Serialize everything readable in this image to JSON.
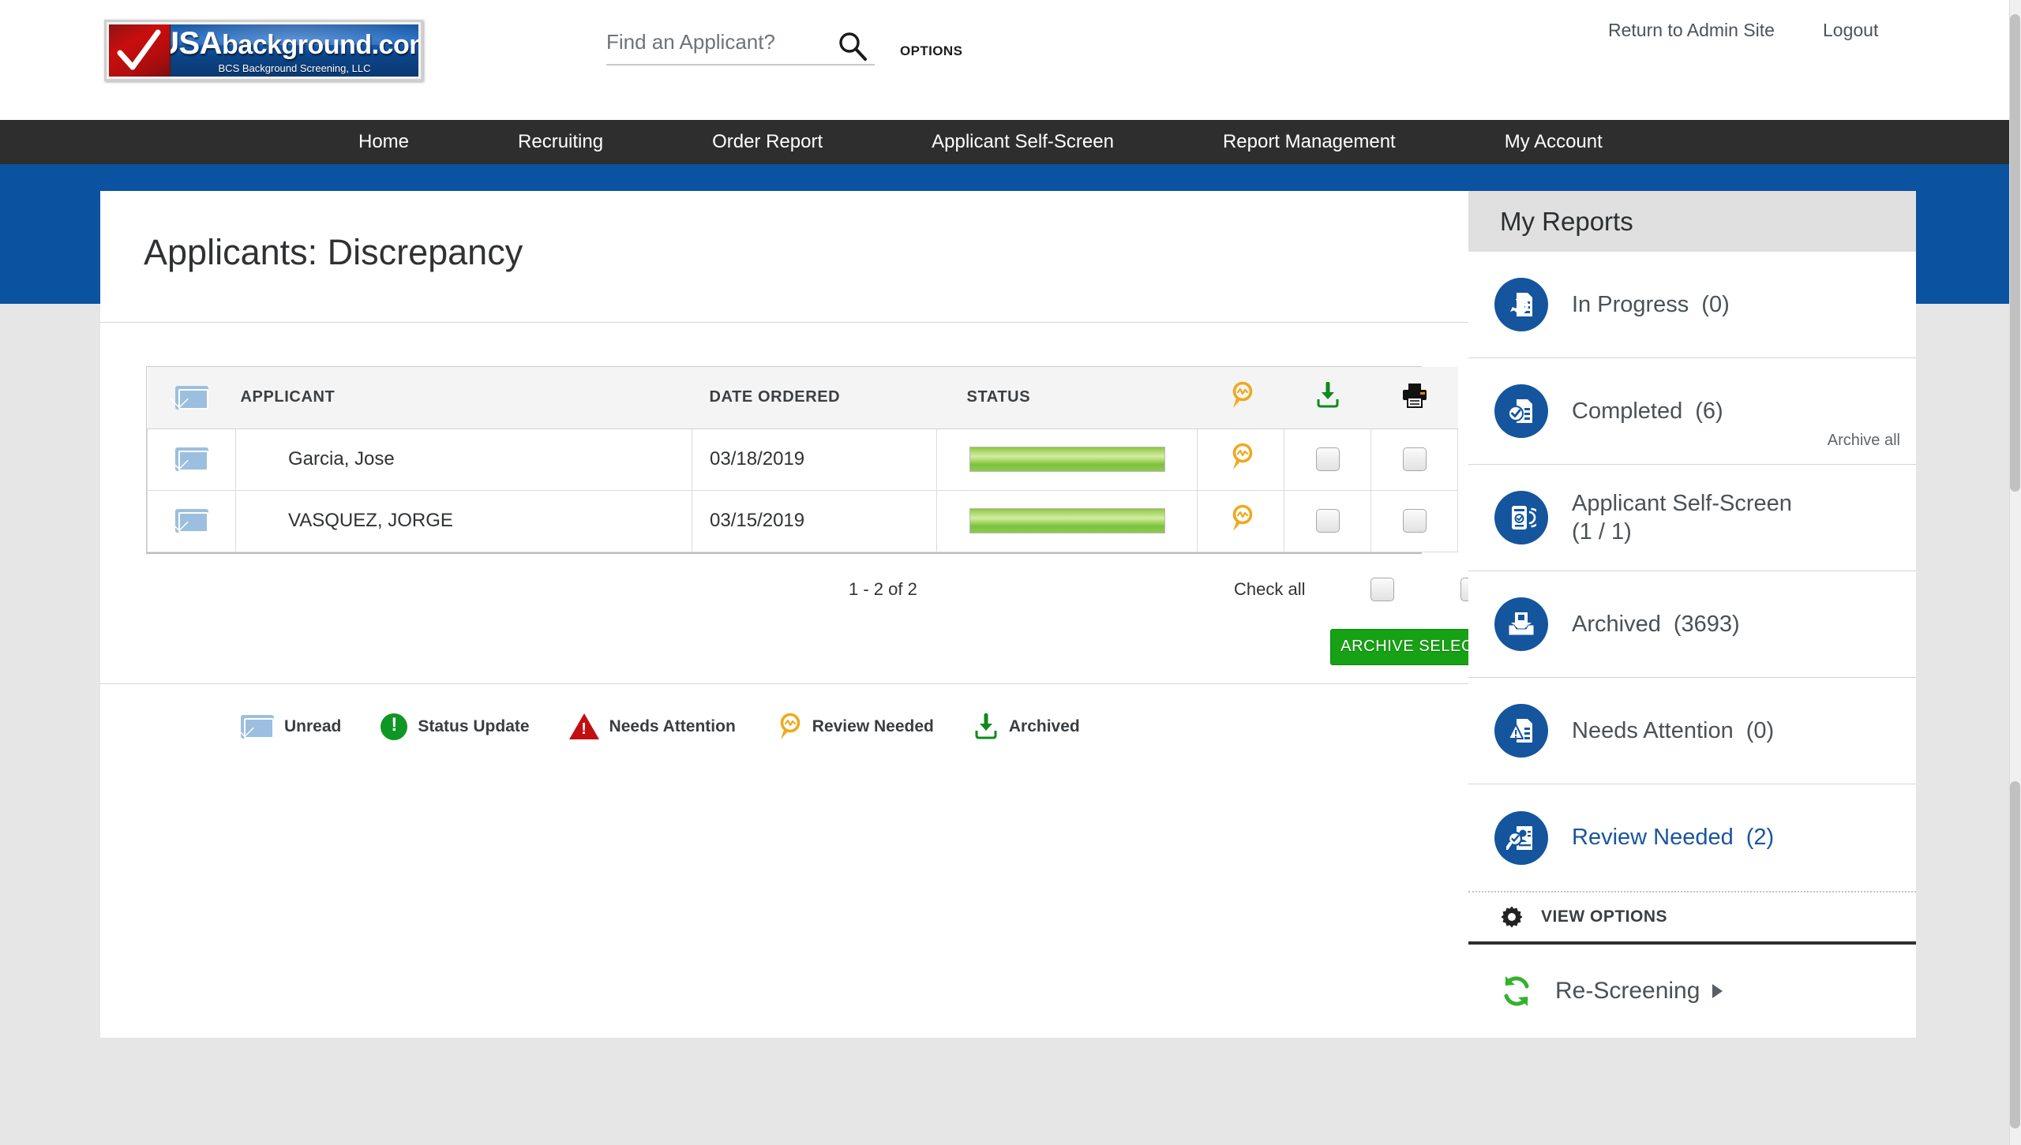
{
  "header": {
    "logo": {
      "main_usa": "USA",
      "main_rest": "background.com",
      "sub": "BCS Background Screening, LLC",
      "check_icon": "checkmark-icon"
    },
    "search": {
      "placeholder": "Find an Applicant?",
      "value": "",
      "icon": "search-icon"
    },
    "options_label": "OPTIONS",
    "admin_link": "Return to Admin Site",
    "logout_link": "Logout"
  },
  "nav": {
    "items": [
      {
        "label": "Home"
      },
      {
        "label": "Recruiting"
      },
      {
        "label": "Order Report"
      },
      {
        "label": "Applicant Self-Screen"
      },
      {
        "label": "Report Management"
      },
      {
        "label": "My Account"
      }
    ]
  },
  "page": {
    "title": "Applicants: Discrepancy"
  },
  "table": {
    "columns": {
      "envelope": "",
      "applicant": "APPLICANT",
      "date_ordered": "DATE ORDERED",
      "status": "STATUS",
      "review": "review-needed-icon",
      "download": "archived-download-icon",
      "print": "printer-icon"
    },
    "rows": [
      {
        "envelope": "unread-envelope-icon",
        "applicant": "Garcia, Jose",
        "date_ordered": "03/18/2019",
        "status_percent": 100,
        "review": "review-needed-icon",
        "download_checked": false,
        "print_checked": false
      },
      {
        "envelope": "unread-envelope-icon",
        "applicant": "VASQUEZ, JORGE",
        "date_ordered": "03/15/2019",
        "status_percent": 100,
        "review": "review-needed-icon",
        "download_checked": false,
        "print_checked": false
      }
    ],
    "pagination": "1 - 2 of 2",
    "check_all_label": "Check all",
    "archive_button": "ARCHIVE SELECTED"
  },
  "legend": {
    "items": [
      {
        "label": "Unread",
        "icon": "unread-envelope-icon",
        "color": "#9dbfdf"
      },
      {
        "label": "Status Update",
        "icon": "status-update-icon",
        "color": "#0f9624"
      },
      {
        "label": "Needs Attention",
        "icon": "needs-attention-icon",
        "color": "#c20f12"
      },
      {
        "label": "Review Needed",
        "icon": "review-needed-icon",
        "color": "#efa91e"
      },
      {
        "label": "Archived",
        "icon": "archived-download-icon",
        "color": "#169c24"
      }
    ]
  },
  "sidebar": {
    "title": "My Reports",
    "items": [
      {
        "label": "In Progress",
        "count": "(0)",
        "icon": "report-in-progress-icon",
        "active": false
      },
      {
        "label": "Completed",
        "count": "(6)",
        "icon": "report-completed-icon",
        "active": false,
        "archive_all": "Archive all"
      },
      {
        "label": "Applicant Self-Screen",
        "count": "(1 / 1)",
        "icon": "self-screen-icon",
        "active": false,
        "two_line": true
      },
      {
        "label": "Archived",
        "count": "(3693)",
        "icon": "archived-box-icon",
        "active": false
      },
      {
        "label": "Needs Attention",
        "count": "(0)",
        "icon": "needs-attention-report-icon",
        "active": false
      },
      {
        "label": "Review Needed",
        "count": "(2)",
        "icon": "review-needed-report-icon",
        "active": true
      }
    ],
    "view_options": {
      "label": "VIEW OPTIONS",
      "icon": "gear-icon"
    },
    "rescreening": {
      "label": "Re-Screening",
      "icon": "refresh-icon"
    }
  },
  "colors": {
    "brand_blue": "#0b53a0",
    "nav_dark": "#2e2e2e",
    "icon_blue": "#14559e",
    "accent_green": "#17a114",
    "status_green": "#8cc63f",
    "review_orange": "#efa91e",
    "page_bg": "#e6e6e6"
  }
}
